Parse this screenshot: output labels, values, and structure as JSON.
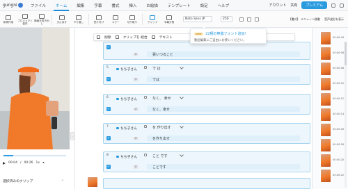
{
  "menubar": {
    "app_name": "gungni",
    "items": [
      "ファイル",
      "ホーム",
      "編集",
      "字幕",
      "書式",
      "挿入",
      "お絵描",
      "テンプレート",
      "設定",
      "ヘルプ"
    ],
    "active": "ホーム",
    "right": {
      "link1": "アカウント",
      "link2": "共有",
      "premium": "プレミアム"
    }
  },
  "ribbon": {
    "tools": [
      {
        "label": "新規作成"
      },
      {
        "label": "プロジェクト保存"
      },
      {
        "label": "動画を書き出し"
      },
      {
        "label": "元に戻す"
      },
      {
        "label": "やり直し"
      },
      {
        "label": "貼り付け"
      },
      {
        "label": "コピー"
      },
      {
        "label": "切り取り"
      },
      {
        "label": "クリップ"
      },
      {
        "label": "字幕分割"
      }
    ],
    "font_family": "Noto Sans JP",
    "font_size": "250",
    "right_tools": [
      "【書式】 メニューへ移動",
      "音声波形を表示"
    ]
  },
  "left": {
    "time_current": "00:04",
    "time_total": "00:26",
    "speed": "1x",
    "timeline_progress": 0.15,
    "section_title": "選択済みのクリップ"
  },
  "subbar": {
    "labels": [
      "削除",
      "クリップを 結合",
      "テキスト"
    ]
  },
  "blocks": [
    {
      "number": "",
      "speaker": "",
      "original": "",
      "subtitle": "買いつること"
    },
    {
      "number": "5",
      "speaker": "ちち子さん",
      "original": "で は",
      "subtitle": "では"
    },
    {
      "number": "6",
      "speaker": "ちち子さん",
      "original": "なく、 幸せ",
      "subtitle": "なく、幸せ"
    },
    {
      "number": "7",
      "speaker": "ちち子さん",
      "original": "を 作り出す",
      "subtitle": "を作り出す"
    },
    {
      "number": "8",
      "speaker": "ちち子さん",
      "original": "こと です",
      "subtitle": "ことです"
    }
  ],
  "tooltip": {
    "badge": "NEW",
    "title": "22種の無償フォント追加！",
    "body": "動画編集にご自由にお使いください。"
  },
  "thumbs": [
    "00:00:04",
    "00:00:06",
    "00:00:08",
    "00:00:10",
    "00:00:12",
    "00:00:14",
    "00:00:16",
    "00:00:18",
    "00:00:20",
    "00:00:22"
  ],
  "colors": {
    "accent": "#2b9be0",
    "block_bg": "#ecf6fc",
    "block_border": "#a8d4ee",
    "video_orange": "#f07a2a"
  }
}
